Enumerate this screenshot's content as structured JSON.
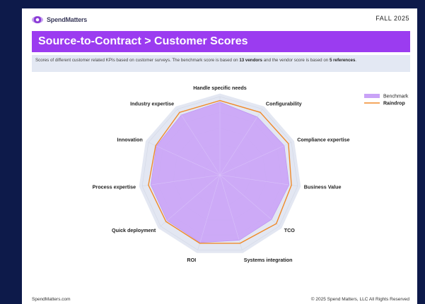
{
  "header": {
    "logo_text": "SpendMatters",
    "season": "FALL 2025",
    "title": "Source-to-Contract > Customer Scores",
    "description_pre": "Scores of different customer related KPIs based on customer surveys. The benchmark score is based on ",
    "vendors": "13 vendors",
    "description_mid": " and the vendor score is based on ",
    "references": "5 references",
    "description_post": "."
  },
  "footer": {
    "left": "SpendMatters.com",
    "right": "© 2025 Spend Matters, LLC All Rights Reserved"
  },
  "colors": {
    "benchmark_fill": "#c9a2f7",
    "raindrop_line": "#f08a2a",
    "grid_band": "#e3e7f2",
    "banner": "#9b3cf0"
  },
  "chart_data": {
    "type": "radar",
    "title": "",
    "axes": [
      "Handle specific needs",
      "Configurability",
      "Compliance expertise",
      "Business Value",
      "TCO",
      "Systems integration",
      "ROI",
      "Quick deployment",
      "Process expertise",
      "Innovation",
      "Industry expertise"
    ],
    "range": [
      0,
      5
    ],
    "series": [
      {
        "name": "Benchmark",
        "values": [
          4.65,
          4.4,
          4.5,
          4.45,
          4.35,
          4.35,
          4.5,
          4.45,
          4.45,
          4.45,
          4.55
        ]
      },
      {
        "name": "Raindrop",
        "values": [
          4.75,
          4.75,
          4.8,
          4.6,
          4.75,
          4.55,
          4.55,
          4.55,
          4.6,
          4.5,
          4.75
        ]
      }
    ],
    "legend_position": "top-right"
  }
}
